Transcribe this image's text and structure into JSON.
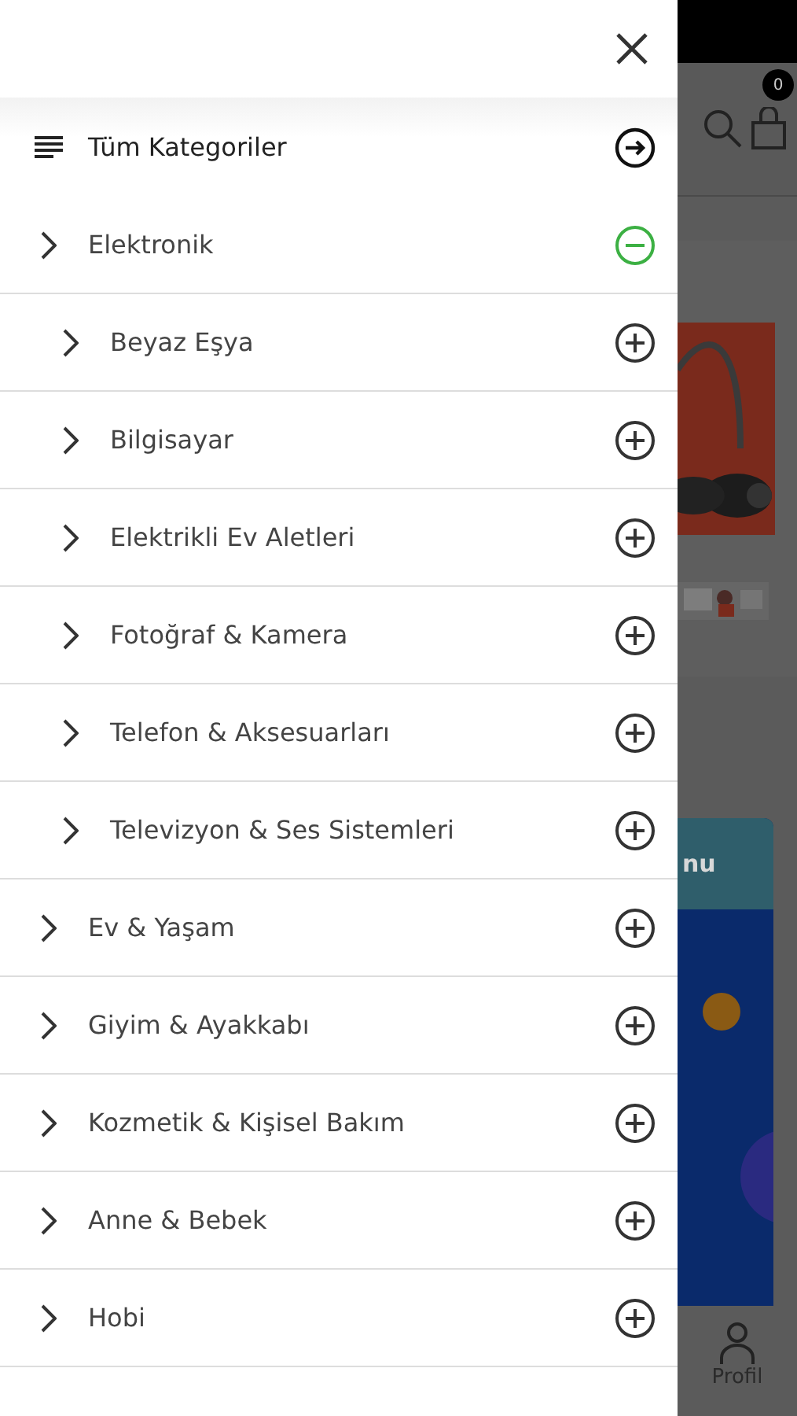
{
  "drawer": {
    "header": {
      "label": "Tüm Kategoriler"
    },
    "categories": [
      {
        "label": "Elektronik",
        "expanded": true,
        "children": [
          {
            "label": "Beyaz Eşya",
            "expanded": false
          },
          {
            "label": "Bilgisayar",
            "expanded": false
          },
          {
            "label": "Elektrikli Ev Aletleri",
            "expanded": false
          },
          {
            "label": "Fotoğraf & Kamera",
            "expanded": false
          },
          {
            "label": "Telefon & Aksesuarları",
            "expanded": false
          },
          {
            "label": "Televizyon & Ses Sistemleri",
            "expanded": false
          }
        ]
      },
      {
        "label": "Ev & Yaşam",
        "expanded": false
      },
      {
        "label": "Giyim & Ayakkabı",
        "expanded": false
      },
      {
        "label": "Kozmetik & Kişisel Bakım",
        "expanded": false
      },
      {
        "label": "Anne & Bebek",
        "expanded": false
      },
      {
        "label": "Hobi",
        "expanded": false
      }
    ]
  },
  "background": {
    "cart_badge": "0",
    "banner_text": "nu",
    "nav_label": "Profil"
  }
}
